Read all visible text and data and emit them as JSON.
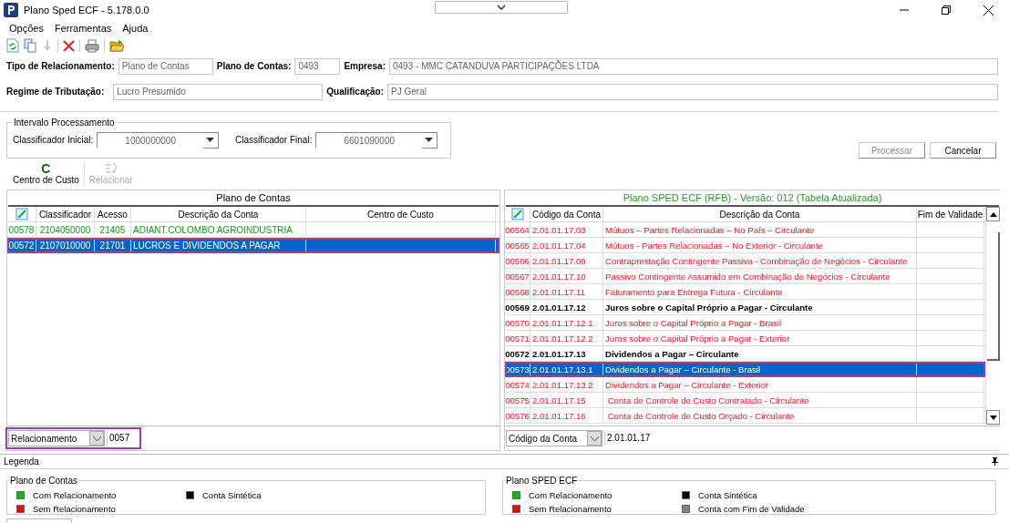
{
  "window": {
    "title": "Plano Sped ECF - 5.178.0.0"
  },
  "menu": [
    "Opções",
    "Ferramentas",
    "Ajuda"
  ],
  "form": {
    "row1": [
      {
        "label": "Tipo de Relacionamento:",
        "value": "Plano de Contas"
      },
      {
        "label": "Plano de Contas:",
        "value": "0493"
      },
      {
        "label": "Empresa:",
        "value": "0493 - MMC CATANDUVA PARTICIPAÇÕES LTDA"
      }
    ],
    "row2": [
      {
        "label": "Regime de Tributação:",
        "value": "Lucro Presumido"
      },
      {
        "label": "Qualificação:",
        "value": "PJ Geral"
      }
    ]
  },
  "interval": {
    "title": "Intervalo Processamento",
    "fields": [
      {
        "label": "Classificador Inicial:",
        "value": "1000000000"
      },
      {
        "label": "Classificador Final:",
        "value": "6601090000"
      }
    ]
  },
  "buttons": [
    {
      "label": "Processar",
      "disabled": true
    },
    {
      "label": "Cancelar",
      "disabled": false
    }
  ],
  "actions": [
    {
      "kind": "letter",
      "glyph": "C",
      "label": "Centro de Custo",
      "disabled": false
    },
    {
      "kind": "relate",
      "label": "Relacionar",
      "disabled": true
    }
  ],
  "left_table": {
    "title": "Plano de Contas",
    "columns": [
      "",
      "Classificador",
      "Acesso",
      "Descrição da Conta",
      "Centro de Custo"
    ],
    "rows": [
      {
        "color": "#1a9a1a",
        "bold": false,
        "selected": false,
        "cells": [
          "00578",
          "2104050000",
          "21405",
          "ADIANT.COLOMBO AGROINDUSTRIA",
          ""
        ]
      },
      {
        "selected": true,
        "cells": [
          "00572",
          "2107010000",
          "21701",
          "LUCROS E DIVIDENDOS A PAGAR",
          ""
        ]
      }
    ],
    "filter": {
      "field": "Relacionamento",
      "value": "0057",
      "highlighted": true
    }
  },
  "right_table": {
    "title": "Plano SPED ECF (RFB) - Versão: 012 (Tabela Atualizada)",
    "columns": [
      "",
      "Código da Conta",
      "Descrição da Conta",
      "Fim de Validade"
    ],
    "rows": [
      {
        "color": "#ff1020",
        "bold": false,
        "selected": false,
        "cells": [
          "00564",
          "2.01.01.17.03",
          "Mútuos – Partes Relacionadas – No País – Circulante",
          ""
        ]
      },
      {
        "color": "#ff1020",
        "bold": false,
        "selected": false,
        "cells": [
          "00565",
          "2.01.01.17.04",
          "Mútuos - Partes Relacionadas – No Exterior - Circulante",
          ""
        ]
      },
      {
        "color": "#ff1020",
        "bold": false,
        "selected": false,
        "cells": [
          "00566",
          "2.01.01.17.09",
          "Contraprestação Contingente Passiva - Combinação de Negócios - Circulante",
          ""
        ]
      },
      {
        "color": "#ff1020",
        "bold": false,
        "selected": false,
        "cells": [
          "00567",
          "2.01.01.17.10",
          "Passivo Contingente Assumido em Combinação de Negócios - Circulante",
          ""
        ]
      },
      {
        "color": "#ff1020",
        "bold": false,
        "selected": false,
        "cells": [
          "00568",
          "2.01.01.17.11",
          "Faturamento para Entrega Futura - Circulante",
          ""
        ]
      },
      {
        "color": "#000000",
        "bold": true,
        "selected": false,
        "cells": [
          "00569",
          "2.01.01.17.12",
          "Juros sobre o Capital Próprio a Pagar - Circulante",
          ""
        ]
      },
      {
        "color": "#ff1020",
        "bold": false,
        "selected": false,
        "cells": [
          "00570",
          "2.01.01.17.12.1",
          "Juros sobre o Capital Próprio a Pagar - Brasil",
          ""
        ]
      },
      {
        "color": "#ff1020",
        "bold": false,
        "selected": false,
        "cells": [
          "00571",
          "2.01.01.17.12.2",
          "Juros sobre o Capital Próprio a Pagar - Exterior",
          ""
        ]
      },
      {
        "color": "#000000",
        "bold": true,
        "selected": false,
        "cells": [
          "00572",
          "2.01.01.17.13",
          "Dividendos a Pagar – Circulante",
          ""
        ]
      },
      {
        "selected": true,
        "cells": [
          "00573",
          "2.01.01.17.13.1",
          "Dividendos a Pagar – Circulante - Brasil",
          ""
        ]
      },
      {
        "color": "#ff1020",
        "bold": false,
        "selected": false,
        "cells": [
          "00574",
          "2.01.01.17.13.2",
          "Dividendos a Pagar – Circulante - Exterior",
          ""
        ]
      },
      {
        "color": "#ff1020",
        "bold": false,
        "selected": false,
        "cells": [
          "00575",
          "2.01.01.17.15",
          " Conta de Controle de Custo Contratado - Circulante",
          ""
        ]
      },
      {
        "color": "#ff1020",
        "bold": false,
        "selected": false,
        "cells": [
          "00576",
          "2.01.01.17.16",
          " Conta de Controle de Custo Orçado - Circulante",
          ""
        ]
      }
    ],
    "filter": {
      "field": "Código da Conta",
      "value": "2.01.01.17",
      "highlighted": false
    }
  },
  "legend": {
    "title": "Legenda",
    "groups": [
      {
        "title": "Plano de Contas",
        "items": [
          {
            "label": "Com Relacionamento",
            "color": "#00c000"
          },
          {
            "label": "Sem Relacionamento",
            "color": "#ff0000"
          },
          {
            "label": "Conta Sintética",
            "color": "#000000"
          }
        ]
      },
      {
        "title": "Plano SPED ECF",
        "items": [
          {
            "label": "Com Relacionamento",
            "color": "#00c000"
          },
          {
            "label": "Sem Relacionamento",
            "color": "#ff0000"
          },
          {
            "label": "Conta Sintética",
            "color": "#000000"
          },
          {
            "label": "Conta com Fim de Validade",
            "color": "#808080"
          }
        ]
      }
    ]
  }
}
